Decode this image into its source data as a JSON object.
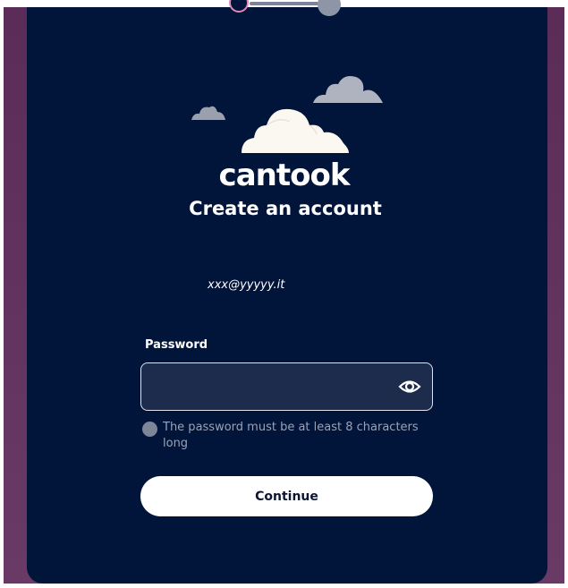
{
  "brand": {
    "logo_text": "cantook",
    "card_color": "#01143a",
    "background_color": "#5b2c58"
  },
  "stepper": {
    "current_step": 1,
    "total_steps": 2
  },
  "header": {
    "title": "Create an account"
  },
  "account": {
    "email": "xxx@yyyyy.it"
  },
  "password": {
    "label": "Password",
    "value": "",
    "placeholder": "",
    "toggle_icon": "eye-icon"
  },
  "requirements": [
    {
      "text": "The password must be at least 8 characters long",
      "met": false
    }
  ],
  "actions": {
    "continue_label": "Continue"
  }
}
